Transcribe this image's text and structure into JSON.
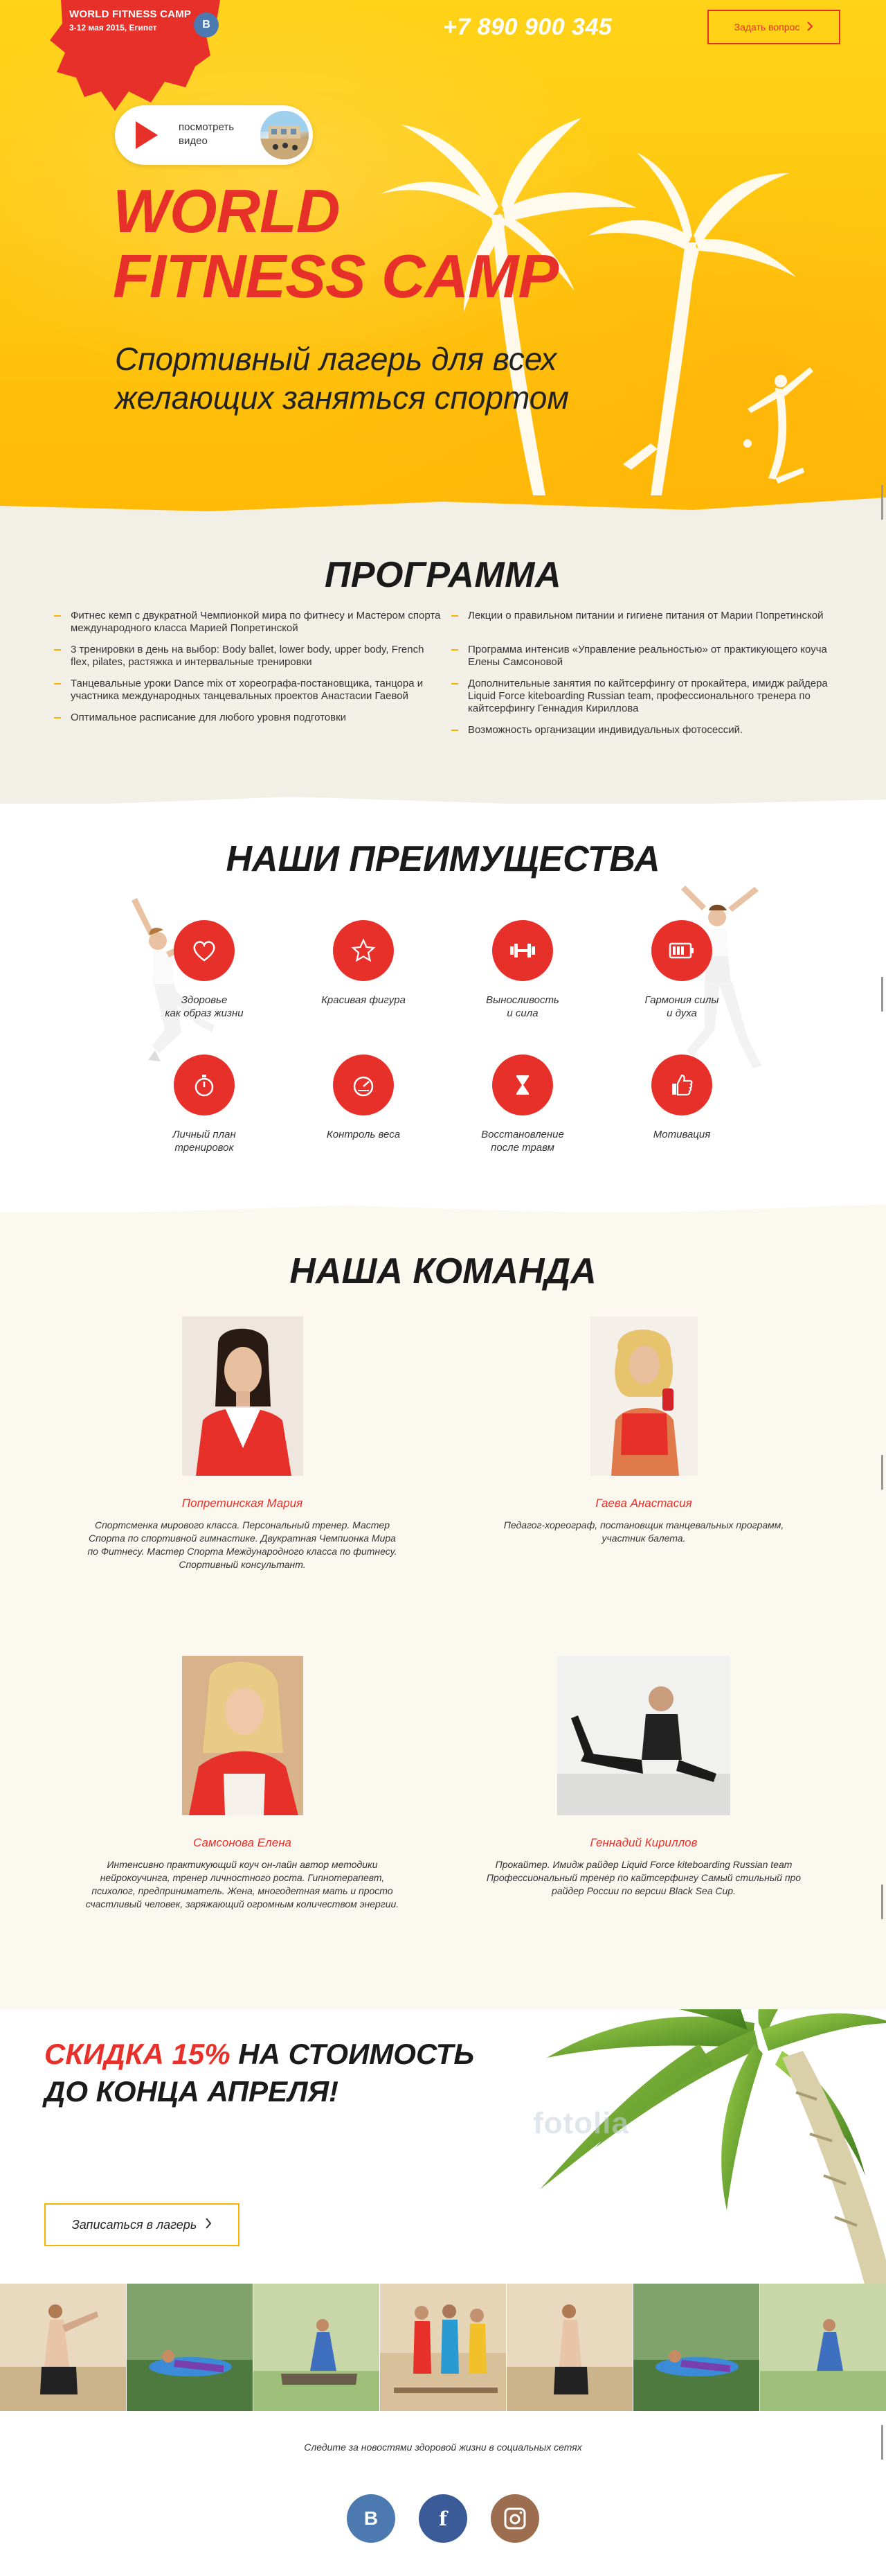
{
  "header": {
    "logo_title": "WORLD FITNESS CAMP",
    "logo_sub": "3-12 мая 2015, Египет",
    "vk_badge": "В",
    "phone": "+7 890 900 345",
    "ask_button": "Задать вопрос"
  },
  "hero": {
    "video_label": "посмотреть видео",
    "title_line1": "WORLD",
    "title_line2": "FITNESS CAMP",
    "subtitle_line1": "Спортивный лагерь для всех",
    "subtitle_line2": "желающих заняться спортом"
  },
  "program": {
    "title": "ПРОГРАММА",
    "left": [
      "Фитнес кемп с двукратной Чемпионкой мира по фитнесу и Мастером спорта международного класса Марией Попретинской",
      "3 тренировки в день на выбор: Body ballet, lower body, upper body, French flex, pilates, растяжка и интервальные тренировки",
      "Танцевальные уроки Dance mix от хореографа-постановщика, танцора и участника международных танцевальных проектов Анастасии Гаевой",
      "Оптимальное расписание для любого уровня подготовки"
    ],
    "right": [
      "Лекции о правильном питании и гигиене питания от Марии Попретинской",
      "Программа интенсив «Управление реальностью» от практикующего коуча Елены Самсоновой",
      "Дополнительные занятия по кайтсерфингу от прокайтера, имидж райдера Liquid Force kiteboarding Russian team, профессионального тренера по кайтсерфингу Геннадия Кириллова",
      "Возможность организации индивидуальных фотосессий."
    ]
  },
  "advantages": {
    "title": "НАШИ ПРЕИМУЩЕСТВА",
    "items": [
      {
        "line1": "Здоровье",
        "line2": "как образ жизни",
        "icon": "heart-icon"
      },
      {
        "line1": "Красивая фигура",
        "line2": "",
        "icon": "star-icon"
      },
      {
        "line1": "Выносливость",
        "line2": "и сила",
        "icon": "dumbbell-icon"
      },
      {
        "line1": "Гармония силы",
        "line2": "и духа",
        "icon": "battery-icon"
      },
      {
        "line1": "Личный план",
        "line2": "тренировок",
        "icon": "stopwatch-icon"
      },
      {
        "line1": "Контроль веса",
        "line2": "",
        "icon": "gauge-icon"
      },
      {
        "line1": "Восстановление",
        "line2": "после травм",
        "icon": "hourglass-icon"
      },
      {
        "line1": "Мотивация",
        "line2": "",
        "icon": "thumbs-up-icon"
      }
    ]
  },
  "team": {
    "title": "НАША КОМАНДА",
    "members": [
      {
        "name": "Попретинская Мария",
        "desc": "Спортсменка мирового класса. Персональный тренер. Мастер Спорта по спортивной гимнастике. Двукратная Чемпионка Мира по Фитнесу. Мастер Спорта Международного класса по фитнесу. Спортивный консультант."
      },
      {
        "name": "Гаева Анастасия",
        "desc": "Педагог-хореограф, постановщик танцевальных программ, участник балета."
      },
      {
        "name": "Самсонова Елена",
        "desc": "Интенсивно практикующий коуч он-лайн автор методики нейрокоучинга, тренер личностного роста. Гипнотерапевт, психолог, предприниматель. Жена, многодетная мать и просто счастливый человек, заряжающий огромным количеством энергии."
      },
      {
        "name": "Геннадий Кириллов",
        "desc": "Прокайтер. Имидж райдер Liquid Force kiteboarding Russian team Профессиональный тренер по кайтсерфингу Самый стильный про райдер России по версии Black Sea Cup."
      }
    ]
  },
  "discount": {
    "red": "СКИДКА 15%",
    "rest_line1": " НА СТОИМОСТЬ",
    "line2": "ДО КОНЦА АПРЕЛЯ!",
    "button": "Записаться в лагерь",
    "watermark": "fotolia"
  },
  "footer": {
    "text": "Следите за новостями здоровой жизни в социальных сетях",
    "vk": "В",
    "fb": "f"
  },
  "colors": {
    "accent_red": "#e8302a",
    "hero_yellow": "#ffc40d",
    "bullet_yellow": "#f5b400",
    "vk_blue": "#4b79b0",
    "fb_blue": "#3b5a98",
    "ig_brown": "#9c6d4e"
  }
}
